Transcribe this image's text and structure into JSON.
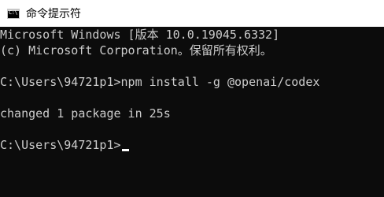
{
  "window": {
    "title": "命令提示符",
    "icon": "cmd-app-icon",
    "icon_text": "C:\\"
  },
  "console": {
    "lines": [
      "Microsoft Windows [版本 10.0.19045.6332]",
      "(c) Microsoft Corporation。保留所有权利。",
      "",
      "C:\\Users\\94721p1>npm install -g @openai/codex",
      "",
      "changed 1 package in 25s",
      "",
      "C:\\Users\\94721p1>"
    ],
    "prompt": "C:\\Users\\94721p1>",
    "command": "npm install -g @openai/codex",
    "output": "changed 1 package in 25s"
  },
  "colors": {
    "console_bg": "#0c0c0c",
    "console_fg": "#cccccc",
    "titlebar_bg": "#ffffff",
    "cursor": "#ffffff"
  }
}
